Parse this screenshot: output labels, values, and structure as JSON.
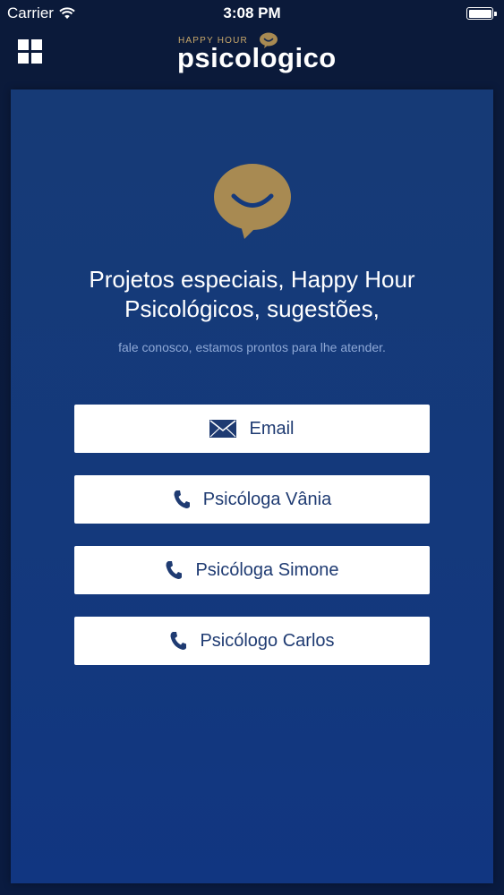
{
  "status_bar": {
    "carrier": "Carrier",
    "time": "3:08 PM"
  },
  "nav": {
    "menu_icon": "grid-menu-icon",
    "brand_small": "HAPPY HOUR",
    "brand_big": "psicologico"
  },
  "colors": {
    "brand_gold": "#a88a52",
    "panel_blue": "#14397c",
    "button_text": "#1f3b72"
  },
  "main": {
    "headline_line1": "Projetos especiais, Happy Hour",
    "headline_line2": "Psicológicos, sugestões,",
    "subtext": "fale conosco, estamos prontos para lhe atender.",
    "buttons": [
      {
        "label": "Email",
        "icon": "envelope-icon"
      },
      {
        "label": "Psicóloga Vânia",
        "icon": "phone-icon"
      },
      {
        "label": "Psicóloga Simone",
        "icon": "phone-icon"
      },
      {
        "label": "Psicólogo Carlos",
        "icon": "phone-icon"
      }
    ]
  }
}
